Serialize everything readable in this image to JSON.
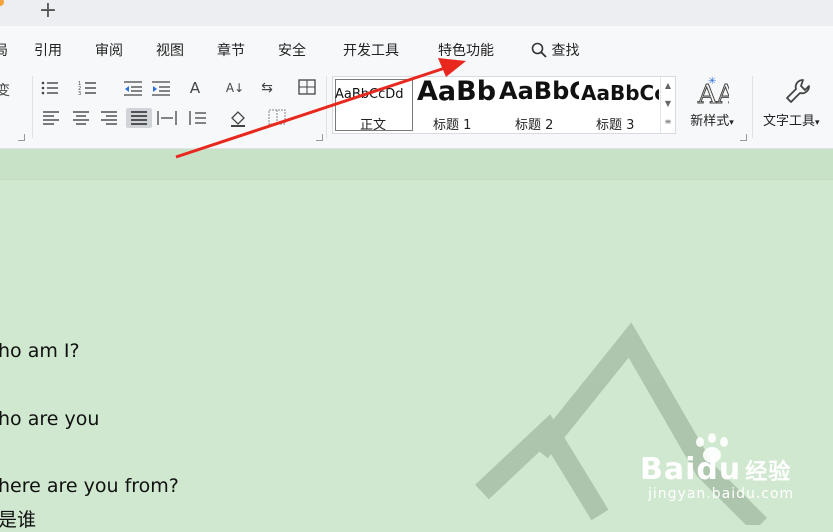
{
  "tabbar": {
    "new_tab_symbol": "+"
  },
  "menu": {
    "items": [
      "局",
      "引用",
      "审阅",
      "视图",
      "章节",
      "安全",
      "开发工具",
      "特色功能"
    ],
    "search_label": "查找"
  },
  "ribbon": {
    "styles": [
      {
        "sample": "AaBbCcDd",
        "name": "正文"
      },
      {
        "sample": "AaBb",
        "name": "标题 1"
      },
      {
        "sample": "AaBbC",
        "name": "标题 2"
      },
      {
        "sample": "AaBbCc",
        "name": "标题 3"
      }
    ],
    "new_style_label": "新样式",
    "text_tools_label": "文字工具",
    "text_tools_caret": "▾",
    "new_style_caret": "▾",
    "left_cut_char": "变"
  },
  "document": {
    "lines": [
      "ho am I?",
      "ho are you",
      "here are you from?",
      "是谁"
    ]
  },
  "watermark": {
    "brand": "Bai",
    "paw": "du",
    "brand_cn": "经验",
    "url": "jingyan.baidu.com"
  },
  "colors": {
    "arrow": "#e8281e",
    "doc_bg": "#cfe8cf",
    "ribbon_bg": "#f7f8f9",
    "accent_orange": "#f5a23a"
  }
}
